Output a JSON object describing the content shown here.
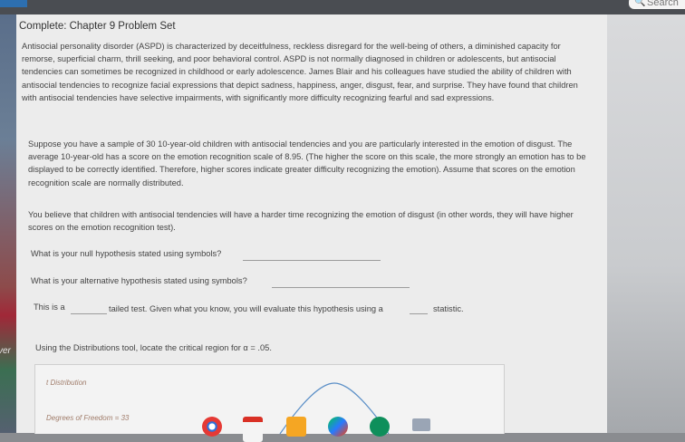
{
  "header": {
    "search_label": "Search"
  },
  "leftbar": {
    "label": "ver"
  },
  "problem": {
    "title": "Complete: Chapter 9 Problem Set",
    "intro": "Antisocial personality disorder (ASPD) is characterized by deceitfulness, reckless disregard for the well-being of others, a diminished capacity for remorse, superficial charm, thrill seeking, and poor behavioral control. ASPD is not normally diagnosed in children or adolescents, but antisocial tendencies can sometimes be recognized in childhood or early adolescence. James Blair and his colleagues have studied the ability of children with antisocial tendencies to recognize facial expressions that depict sadness, happiness, anger, disgust, fear, and surprise. They have found that children with antisocial tendencies have selective impairments, with significantly more difficulty recognizing fearful and sad expressions.",
    "scenario": "Suppose you have a sample of 30 10-year-old children with antisocial tendencies and you are particularly interested in the emotion of disgust. The average 10-year-old has a score on the emotion recognition scale of 8.95. (The higher the score on this scale, the more strongly an emotion has to be displayed to be correctly identified. Therefore, higher scores indicate greater difficulty recognizing the emotion). Assume that scores on the emotion recognition scale are normally distributed.",
    "belief": "You believe that children with antisocial tendencies will have a harder time recognizing the emotion of disgust (in other words, they will have higher scores on the emotion recognition test).",
    "q_null": "What is your null hypothesis stated using symbols?",
    "q_alt": "What is your alternative hypothesis stated using symbols?",
    "q_tail_a": "This is a",
    "q_tail_b": "tailed test. Given what you know, you will evaluate this hypothesis using a",
    "q_tail_c": "statistic.",
    "q_critical": "Using the Distributions tool, locate the critical region for α = .05."
  },
  "tool": {
    "title": "t Distribution",
    "df_label": "Degrees of Freedom = 33"
  },
  "taskbar": {
    "icons": [
      "chrome-icon",
      "gmail-icon",
      "slides-icon",
      "play-store-icon",
      "meet-icon"
    ]
  }
}
